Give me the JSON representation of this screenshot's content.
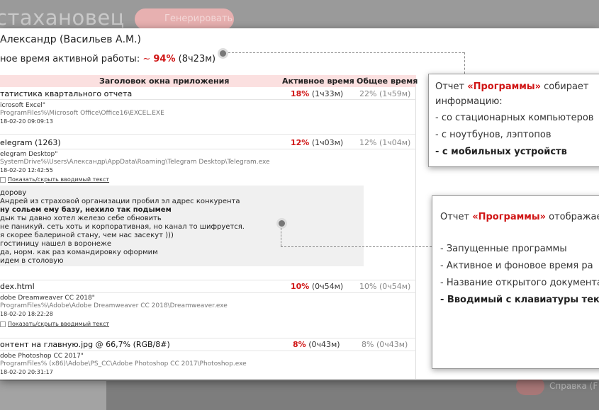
{
  "background": {
    "app_title": "стахановец",
    "generate_button": "Генерировать",
    "help_text": "Справка (F"
  },
  "report": {
    "user": "Александр (Васильев А.М.)",
    "active_prefix": "ное время активной работы:",
    "active_tilde": "~",
    "active_pct": "94%",
    "active_time": "(8ч23м)"
  },
  "table": {
    "headers": [
      "Заголовок окна приложения",
      "Активное время",
      "Общее время"
    ],
    "rows": [
      {
        "title": "татистика квартального отчета",
        "act_pct": "18%",
        "act_time": "(1ч33м)",
        "total": "22% (1ч59м)",
        "app": "icrosoft Excel\"",
        "path": "ProgramFiles%\\Microsoft Office\\Office16\\EXCEL.EXE",
        "date": "18-02-20 09:09:13"
      },
      {
        "title": "elegram (1263)",
        "act_pct": "12%",
        "act_time": "(1ч03м)",
        "total": "12% (1ч04м)",
        "app": "elegram Desktop\"",
        "path": "SystemDrive%\\Users\\Александр\\AppData\\Roaming\\Telegram Desktop\\Telegram.exe",
        "date": "18-02-20 12:42:55",
        "toggle": "Показать/скрыть вводимый текст"
      },
      {
        "title": "dex.html",
        "act_pct": "10%",
        "act_time": "(0ч54м)",
        "total": "10% (0ч54м)",
        "app": "dobe Dreamweaver CC 2018\"",
        "path": "ProgramFiles%\\Adobe\\Adobe Dreamweaver CC 2018\\Dreamweaver.exe",
        "date": "18-02-20 18:22:28",
        "toggle": "Показать/скрыть вводимый текст"
      },
      {
        "title": "онтент на главную.jpg @ 66,7% (RGB/8#)",
        "act_pct": "8%",
        "act_time": "(0ч43м)",
        "total": "8% (0ч43м)",
        "app": "dobe Photoshop CC 2017\"",
        "path": "ProgramFiles% (x86)\\Adobe\\PS_CC\\Adobe Photoshop CC 2017\\Photoshop.exe",
        "date": "18-02-20 20:31:17"
      }
    ],
    "typed_text": [
      "дорову",
      "Андрей из страховой организации пробил эл адрес конкурента",
      "ну сольем ему базу, нехило так подымем",
      "дык ты давно хотел железо себе обновить",
      "не паникуй. сеть хоть и корпоративная, но канал то шифруется.",
      "я скорее балериной стану, чем нас засекут )))",
      "гостиницу нашел в воронеже",
      "да, норм. как раз командировку оформим",
      "идем в столовую"
    ]
  },
  "callout1": {
    "line1_prefix": "Отчет ",
    "line1_red": "«Программы»",
    "line1_suffix": " собирает",
    "line2": "информацию:",
    "items": [
      "- со стационарных компьютеров",
      "- с ноутбунов, лэптопов"
    ],
    "bold_item": "- с мобильных устройств"
  },
  "callout2": {
    "line1_prefix": "Отчет ",
    "line1_red": "«Программы»",
    "line1_suffix": " отображае",
    "items": [
      "- Запущенные программы",
      "- Активное и фоновое время ра",
      "- Название открытого документа"
    ],
    "bold_item": "- Вводимый с клавиатуры текс"
  }
}
